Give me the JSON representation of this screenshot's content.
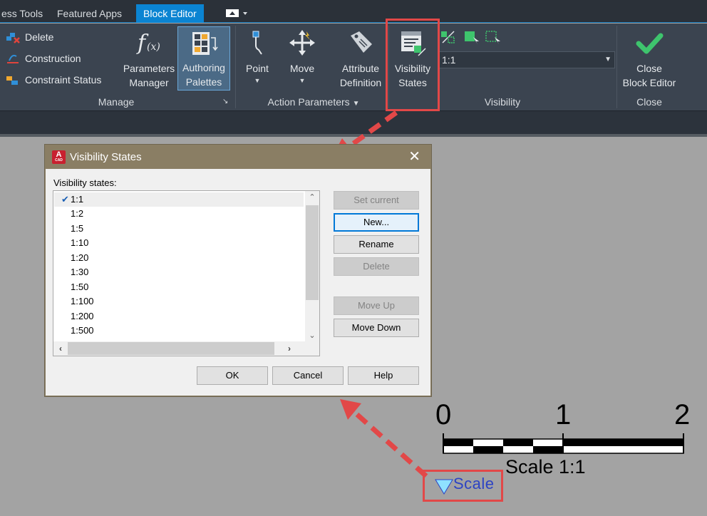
{
  "tabs": [
    "ess Tools",
    "Featured Apps",
    "Block Editor"
  ],
  "ribbon": {
    "manage": {
      "small_items": [
        "Delete",
        "Construction",
        "Constraint Status"
      ],
      "parameters_manager": [
        "Parameters",
        "Manager"
      ],
      "authoring_palettes": [
        "Authoring",
        "Palettes"
      ],
      "label": "Manage"
    },
    "action_parameters": {
      "point": "Point",
      "move": "Move",
      "attribute_definition": [
        "Attribute",
        "Definition"
      ],
      "label": "Action Parameters"
    },
    "visibility": {
      "visibility_states": [
        "Visibility",
        "States"
      ],
      "current_state": "1:1",
      "label": "Visibility"
    },
    "close": {
      "close_block_editor": [
        "Close",
        "Block Editor"
      ],
      "label": "Close"
    }
  },
  "dialog": {
    "title": "Visibility States",
    "app_icon_letter": "A",
    "app_icon_sub": "CAD",
    "list_label": "Visibility states:",
    "states": [
      "1:1",
      "1:2",
      "1:5",
      "1:10",
      "1:20",
      "1:30",
      "1:50",
      "1:100",
      "1:200",
      "1:500"
    ],
    "current_state_index": 0,
    "buttons": {
      "set_current": "Set current",
      "new": "New...",
      "rename": "Rename",
      "delete": "Delete",
      "move_up": "Move Up",
      "move_down": "Move Down",
      "ok": "OK",
      "cancel": "Cancel",
      "help": "Help"
    }
  },
  "scale_bar": {
    "ticks": [
      "0",
      "1",
      "2"
    ],
    "label": "Scale 1:1"
  },
  "scale_parameter": {
    "label": "Scale"
  },
  "colors": {
    "ribbon": "#3b4450",
    "active_tab": "#0b84d2",
    "dialog_titlebar": "#8a7e64",
    "annotation_red": "#e24848",
    "canvas": "#a3a3a3"
  }
}
